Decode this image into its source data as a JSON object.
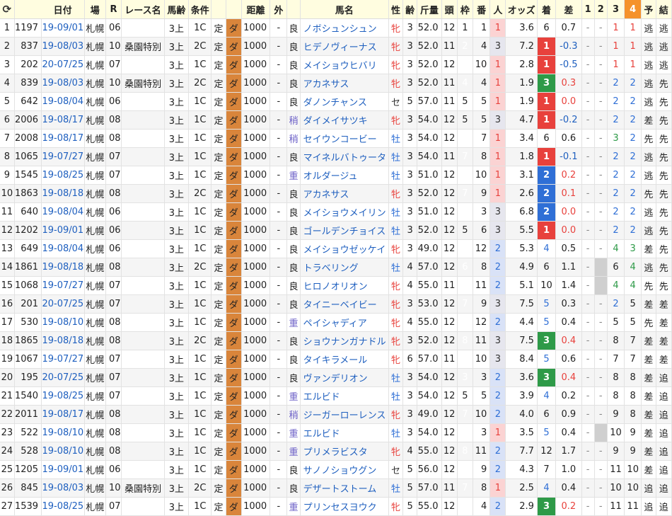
{
  "headers": [
    "⟳",
    "日付",
    "場",
    "R",
    "レース名",
    "馬齢",
    "条件",
    "",
    "",
    "距離",
    "外",
    "",
    "馬名",
    "性",
    "齢",
    "斤量",
    "頭",
    "枠",
    "番",
    "人",
    "オッズ",
    "着",
    "差",
    "1",
    "2",
    "3",
    "4",
    "予",
    "結"
  ],
  "rows": [
    [
      "1",
      "1197",
      "19-09/01",
      "札幌",
      "06",
      "",
      "3上",
      "1C",
      "定",
      "ダ",
      "1000",
      "-",
      "良",
      "ノボシュンシュン",
      "牝",
      "3",
      "52.0",
      "12",
      "1",
      "1",
      "1",
      "3.6",
      "6",
      "0.7",
      "-",
      "-",
      "1",
      "1",
      "逃",
      "逃"
    ],
    [
      "2",
      "837",
      "19-08/03",
      "札幌",
      "10",
      "桑園特別",
      "3上",
      "2C",
      "定",
      "ダ",
      "1000",
      "-",
      "良",
      "ヒデノヴィーナス",
      "牝",
      "3",
      "52.0",
      "11",
      "2",
      "4",
      "3",
      "7.2",
      "1",
      "-0.3",
      "-",
      "-",
      "1",
      "1",
      "逃",
      "逃"
    ],
    [
      "3",
      "202",
      "20-07/25",
      "札幌",
      "07",
      "",
      "3上",
      "1C",
      "定",
      "ダ",
      "1000",
      "-",
      "良",
      "メイショウヒバリ",
      "牝",
      "3",
      "52.0",
      "12",
      "7",
      "10",
      "1",
      "2.8",
      "1",
      "-0.5",
      "-",
      "-",
      "1",
      "1",
      "逃",
      "逃"
    ],
    [
      "4",
      "839",
      "19-08/03",
      "札幌",
      "10",
      "桑園特別",
      "3上",
      "2C",
      "定",
      "ダ",
      "1000",
      "-",
      "良",
      "アカネサス",
      "牝",
      "3",
      "52.0",
      "11",
      "4",
      "4",
      "1",
      "1.9",
      "3",
      "0.3",
      "-",
      "-",
      "2",
      "2",
      "逃",
      "先"
    ],
    [
      "5",
      "642",
      "19-08/04",
      "札幌",
      "06",
      "",
      "3上",
      "1C",
      "定",
      "ダ",
      "1000",
      "-",
      "良",
      "ダノンチャンス",
      "セ",
      "5",
      "57.0",
      "11",
      "5",
      "5",
      "1",
      "1.9",
      "1",
      "0.0",
      "-",
      "-",
      "2",
      "2",
      "逃",
      "先"
    ],
    [
      "6",
      "2006",
      "19-08/17",
      "札幌",
      "08",
      "",
      "3上",
      "1C",
      "定",
      "ダ",
      "1000",
      "-",
      "稍",
      "ダイメイサツキ",
      "牝",
      "3",
      "54.0",
      "12",
      "5",
      "5",
      "3",
      "4.7",
      "1",
      "-0.2",
      "-",
      "-",
      "2",
      "2",
      "差",
      "先"
    ],
    [
      "7",
      "2008",
      "19-08/17",
      "札幌",
      "08",
      "",
      "3上",
      "1C",
      "定",
      "ダ",
      "1000",
      "-",
      "稍",
      "セイウンコービー",
      "牡",
      "3",
      "54.0",
      "12",
      "6",
      "7",
      "1",
      "3.4",
      "6",
      "0.6",
      "-",
      "-",
      "3",
      "2",
      "先",
      "先"
    ],
    [
      "8",
      "1065",
      "19-07/27",
      "札幌",
      "07",
      "",
      "3上",
      "1C",
      "定",
      "ダ",
      "1000",
      "-",
      "良",
      "マイネルバトゥータ",
      "牡",
      "3",
      "54.0",
      "11",
      "7",
      "8",
      "1",
      "1.8",
      "1",
      "-0.1",
      "-",
      "-",
      "2",
      "2",
      "逃",
      "先"
    ],
    [
      "9",
      "1545",
      "19-08/25",
      "札幌",
      "07",
      "",
      "3上",
      "1C",
      "定",
      "ダ",
      "1000",
      "-",
      "重",
      "オルダージュ",
      "牡",
      "3",
      "51.0",
      "12",
      "7",
      "10",
      "1",
      "3.1",
      "2",
      "0.2",
      "-",
      "-",
      "2",
      "2",
      "逃",
      "先"
    ],
    [
      "10",
      "1863",
      "19-08/18",
      "札幌",
      "08",
      "",
      "3上",
      "2C",
      "定",
      "ダ",
      "1000",
      "-",
      "良",
      "アカネサス",
      "牝",
      "3",
      "52.0",
      "12",
      "7",
      "9",
      "1",
      "2.6",
      "2",
      "0.1",
      "-",
      "-",
      "2",
      "2",
      "先",
      "先"
    ],
    [
      "11",
      "640",
      "19-08/04",
      "札幌",
      "06",
      "",
      "3上",
      "1C",
      "定",
      "ダ",
      "1000",
      "-",
      "良",
      "メイショウメイリン",
      "牡",
      "3",
      "51.0",
      "12",
      "3",
      "3",
      "3",
      "6.8",
      "2",
      "0.0",
      "-",
      "-",
      "2",
      "2",
      "逃",
      "先"
    ],
    [
      "12",
      "1202",
      "19-09/01",
      "札幌",
      "06",
      "",
      "3上",
      "1C",
      "定",
      "ダ",
      "1000",
      "-",
      "良",
      "ゴールデンチョイス",
      "牡",
      "3",
      "52.0",
      "12",
      "5",
      "6",
      "3",
      "5.5",
      "1",
      "0.0",
      "-",
      "-",
      "2",
      "2",
      "逃",
      "先"
    ],
    [
      "13",
      "649",
      "19-08/04",
      "札幌",
      "06",
      "",
      "3上",
      "1C",
      "定",
      "ダ",
      "1000",
      "-",
      "良",
      "メイショウゼッケイ",
      "牝",
      "3",
      "49.0",
      "12",
      "8",
      "12",
      "2",
      "5.3",
      "4",
      "0.5",
      "-",
      "-",
      "4",
      "3",
      "差",
      "先"
    ],
    [
      "14",
      "1861",
      "19-08/18",
      "札幌",
      "08",
      "",
      "3上",
      "2C",
      "定",
      "ダ",
      "1000",
      "-",
      "良",
      "トラベリング",
      "牡",
      "4",
      "57.0",
      "12",
      "6",
      "8",
      "2",
      "4.9",
      "6",
      "1.1",
      "-",
      "",
      "6",
      "4",
      "逃",
      "先"
    ],
    [
      "15",
      "1068",
      "19-07/27",
      "札幌",
      "07",
      "",
      "3上",
      "1C",
      "定",
      "ダ",
      "1000",
      "-",
      "良",
      "ヒロノオリオン",
      "牝",
      "4",
      "55.0",
      "11",
      "8",
      "11",
      "2",
      "5.1",
      "10",
      "1.4",
      "-",
      "",
      "4",
      "4",
      "先",
      "先"
    ],
    [
      "16",
      "201",
      "20-07/25",
      "札幌",
      "07",
      "",
      "3上",
      "1C",
      "定",
      "ダ",
      "1000",
      "-",
      "良",
      "タイニーベイビー",
      "牝",
      "3",
      "53.0",
      "12",
      "7",
      "9",
      "3",
      "7.5",
      "5",
      "0.3",
      "-",
      "-",
      "2",
      "5",
      "差",
      "差"
    ],
    [
      "17",
      "530",
      "19-08/10",
      "札幌",
      "08",
      "",
      "3上",
      "1C",
      "定",
      "ダ",
      "1000",
      "-",
      "重",
      "ペイシャディア",
      "牝",
      "4",
      "55.0",
      "12",
      "8",
      "12",
      "2",
      "4.4",
      "5",
      "0.4",
      "-",
      "-",
      "5",
      "5",
      "先",
      "差"
    ],
    [
      "18",
      "1865",
      "19-08/18",
      "札幌",
      "08",
      "",
      "3上",
      "2C",
      "定",
      "ダ",
      "1000",
      "-",
      "良",
      "ショウナンガナドル",
      "牝",
      "3",
      "52.0",
      "12",
      "8",
      "11",
      "3",
      "7.5",
      "3",
      "0.4",
      "-",
      "-",
      "8",
      "7",
      "差",
      "差"
    ],
    [
      "19",
      "1067",
      "19-07/27",
      "札幌",
      "07",
      "",
      "3上",
      "1C",
      "定",
      "ダ",
      "1000",
      "-",
      "良",
      "タイキラメール",
      "牝",
      "6",
      "57.0",
      "11",
      "8",
      "10",
      "3",
      "8.4",
      "5",
      "0.6",
      "-",
      "-",
      "7",
      "7",
      "差",
      "差"
    ],
    [
      "20",
      "195",
      "20-07/25",
      "札幌",
      "07",
      "",
      "3上",
      "1C",
      "定",
      "ダ",
      "1000",
      "-",
      "良",
      "ヴァンデリオン",
      "牡",
      "3",
      "54.0",
      "12",
      "3",
      "3",
      "2",
      "3.6",
      "3",
      "0.4",
      "-",
      "-",
      "8",
      "8",
      "差",
      "追"
    ],
    [
      "21",
      "1540",
      "19-08/25",
      "札幌",
      "07",
      "",
      "3上",
      "1C",
      "定",
      "ダ",
      "1000",
      "-",
      "重",
      "エルビド",
      "牡",
      "3",
      "54.0",
      "12",
      "5",
      "5",
      "2",
      "3.9",
      "4",
      "0.2",
      "-",
      "-",
      "8",
      "8",
      "差",
      "追"
    ],
    [
      "22",
      "2011",
      "19-08/17",
      "札幌",
      "08",
      "",
      "3上",
      "1C",
      "定",
      "ダ",
      "1000",
      "-",
      "稍",
      "ジーガーローレンス",
      "牝",
      "3",
      "49.0",
      "12",
      "7",
      "10",
      "2",
      "4.0",
      "6",
      "0.9",
      "-",
      "-",
      "9",
      "8",
      "差",
      "追"
    ],
    [
      "23",
      "522",
      "19-08/10",
      "札幌",
      "08",
      "",
      "3上",
      "1C",
      "定",
      "ダ",
      "1000",
      "-",
      "重",
      "エルビド",
      "牡",
      "3",
      "54.0",
      "12",
      "3",
      "3",
      "1",
      "3.5",
      "5",
      "0.4",
      "-",
      "",
      "10",
      "9",
      "差",
      "追"
    ],
    [
      "24",
      "528",
      "19-08/10",
      "札幌",
      "08",
      "",
      "3上",
      "1C",
      "定",
      "ダ",
      "1000",
      "-",
      "重",
      "プリメラビスタ",
      "牝",
      "4",
      "55.0",
      "12",
      "8",
      "11",
      "2",
      "7.7",
      "12",
      "1.7",
      "-",
      "-",
      "9",
      "9",
      "差",
      "追"
    ],
    [
      "25",
      "1205",
      "19-09/01",
      "札幌",
      "06",
      "",
      "3上",
      "1C",
      "定",
      "ダ",
      "1000",
      "-",
      "良",
      "サノノショウグン",
      "セ",
      "5",
      "56.0",
      "12",
      "7",
      "9",
      "2",
      "4.3",
      "7",
      "1.0",
      "-",
      "-",
      "11",
      "10",
      "差",
      "追"
    ],
    [
      "26",
      "845",
      "19-08/03",
      "札幌",
      "10",
      "桑園特別",
      "3上",
      "2C",
      "定",
      "ダ",
      "1000",
      "-",
      "良",
      "デザートストーム",
      "牡",
      "5",
      "57.0",
      "11",
      "7",
      "8",
      "1",
      "2.5",
      "4",
      "0.4",
      "-",
      "-",
      "10",
      "10",
      "追",
      "追"
    ],
    [
      "27",
      "1539",
      "19-08/25",
      "札幌",
      "07",
      "",
      "3上",
      "1C",
      "定",
      "ダ",
      "1000",
      "-",
      "重",
      "プリンセスヨウク",
      "牝",
      "5",
      "55.0",
      "12",
      "4",
      "4",
      "2",
      "2.9",
      "3",
      "0.2",
      "-",
      "-",
      "11",
      "11",
      "追",
      "追"
    ]
  ],
  "colors": {
    "dirt": "#d9853b",
    "header_bg": "#fffde0",
    "link": "#1e5fbf",
    "highlight": "#f5922b"
  }
}
